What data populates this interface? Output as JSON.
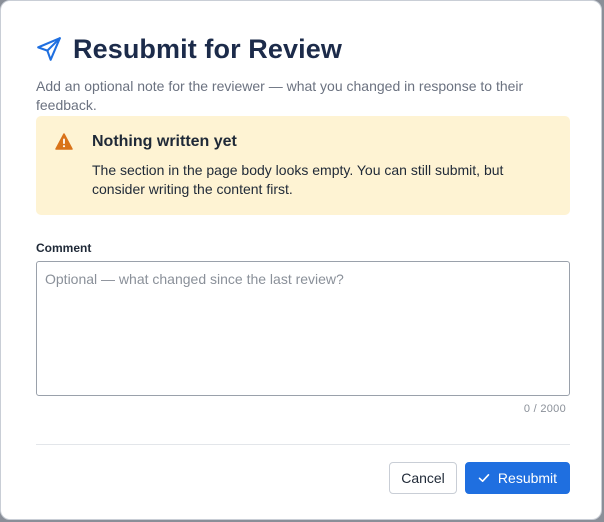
{
  "dialog": {
    "title": "Resubmit for Review",
    "title_icon": "send-icon",
    "subtitle": "Add an optional note for the reviewer — what you changed in response to their feedback."
  },
  "warning": {
    "icon": "warning-icon",
    "title": "Nothing written yet",
    "message": "The section in the page body looks empty. You can still submit, but consider writing the content first."
  },
  "comment": {
    "label": "Comment",
    "value": "",
    "placeholder": "Optional — what changed since the last review?",
    "char_count": "0 / 2000"
  },
  "actions": {
    "cancel_label": "Cancel",
    "submit_label": "Resubmit",
    "submit_icon": "check-icon"
  },
  "colors": {
    "title": "#1c2b4a",
    "accent": "#1f6fe0",
    "warning_bg": "#fef3d3",
    "warning_icon": "#d9731a"
  }
}
